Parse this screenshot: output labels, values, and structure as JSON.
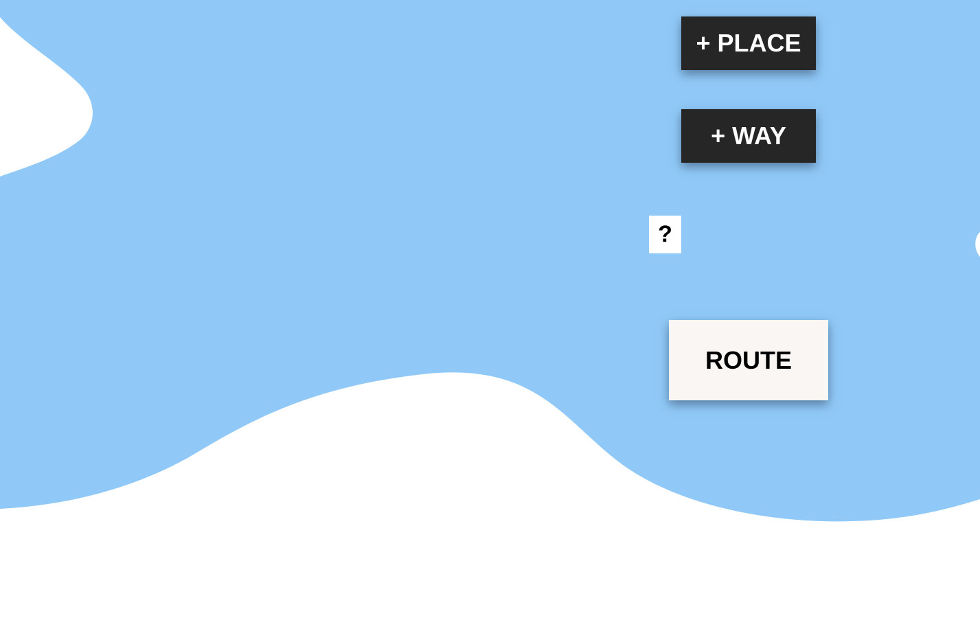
{
  "colors": {
    "water": "#90c9f7",
    "land": "#ffffff",
    "dark_button": "#262626",
    "light_button": "#faf6f4"
  },
  "controls": {
    "add_place_label": "+ PLACE",
    "add_way_label": "+ WAY",
    "help_label": "?",
    "route_label": "ROUTE"
  }
}
